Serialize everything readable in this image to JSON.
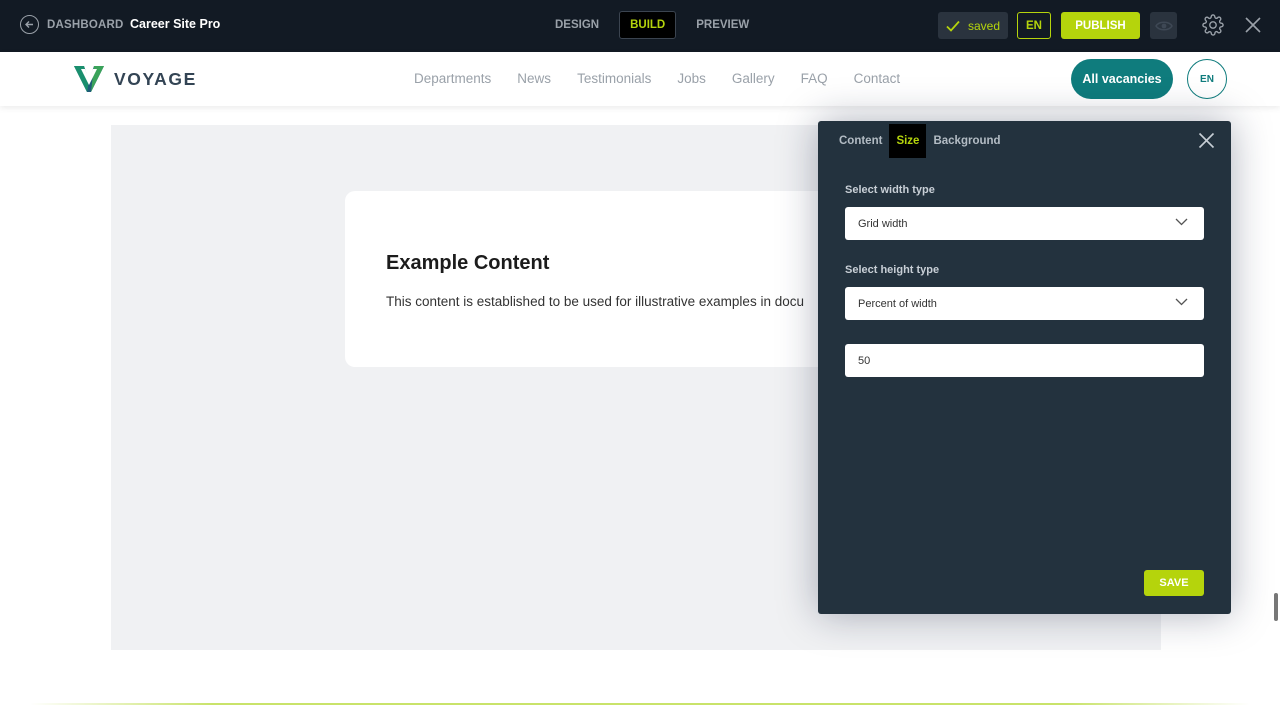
{
  "editor": {
    "back_label": "DASHBOARD",
    "site_name": "Career Site Pro",
    "modes": [
      "DESIGN",
      "BUILD",
      "PREVIEW"
    ],
    "active_mode": "BUILD",
    "saved_label": "saved",
    "lang": "EN",
    "publish_label": "PUBLISH",
    "accent_color": "#b5d40c",
    "bg_color": "#121a24"
  },
  "site": {
    "logo_text": "VOYAGE",
    "nav": [
      "Departments",
      "News",
      "Testimonials",
      "Jobs",
      "Gallery",
      "FAQ",
      "Contact"
    ],
    "cta_label": "All vacancies",
    "lang": "EN",
    "brand_color": "#0f7c7d"
  },
  "content": {
    "title": "Example Content",
    "body": "This content is established to be used for illustrative examples in docu"
  },
  "panel": {
    "tabs": [
      "Content",
      "Size",
      "Background"
    ],
    "active_tab": "Size",
    "width_label": "Select width type",
    "width_value": "Grid width",
    "height_label": "Select height type",
    "height_value": "Percent of width",
    "percent_value": "50",
    "save_label": "SAVE"
  }
}
